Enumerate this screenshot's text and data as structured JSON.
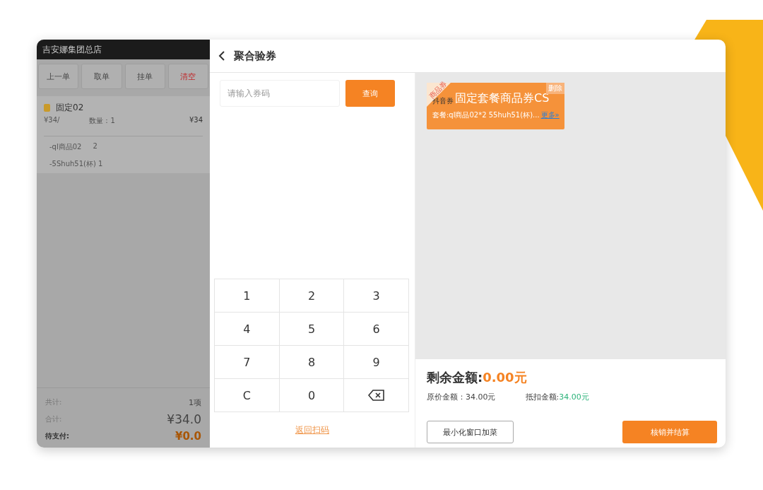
{
  "store": {
    "name": "吉安娜集团总店"
  },
  "order_buttons": [
    {
      "label": "上一单",
      "kind": "normal"
    },
    {
      "label": "取单",
      "kind": "normal"
    },
    {
      "label": "挂单",
      "kind": "normal"
    },
    {
      "label": "清空",
      "kind": "danger"
    }
  ],
  "order_item": {
    "name": "固定02",
    "unit_price": "¥34/",
    "quantity": "数量：1",
    "price": "¥34",
    "sub_items": [
      {
        "name": "-ql商品02",
        "count": "2"
      },
      {
        "name": "-5Shuh51(杯) 1"
      }
    ]
  },
  "totals": [
    {
      "label": "共计:",
      "value": "1项",
      "kind": "count"
    },
    {
      "label": "合计:",
      "value": "¥34.0",
      "kind": "total"
    },
    {
      "label": "待支付:",
      "value": "¥0.0",
      "kind": "due"
    }
  ],
  "header": {
    "title": "聚合验券"
  },
  "search": {
    "placeholder": "请输入券码",
    "button": "查询"
  },
  "keypad": [
    {
      "label": "1",
      "kind": "key"
    },
    {
      "label": "2",
      "kind": "key"
    },
    {
      "label": "3",
      "kind": "key"
    },
    {
      "label": "4",
      "kind": "key"
    },
    {
      "label": "5",
      "kind": "key"
    },
    {
      "label": "6",
      "kind": "key"
    },
    {
      "label": "7",
      "kind": "key"
    },
    {
      "label": "8",
      "kind": "key"
    },
    {
      "label": "9",
      "kind": "key"
    },
    {
      "label": "C",
      "kind": "key"
    },
    {
      "label": "0",
      "kind": "key"
    },
    {
      "kind": "backspace"
    }
  ],
  "back_link": "返回扫码",
  "coupon": {
    "corner": "商品券",
    "platform": "抖音券",
    "title": "固定套餐商品券CS",
    "tag": "删除",
    "desc": "套餐:ql商品02*2 55huh51(杯)...",
    "more": "更多»"
  },
  "summary": {
    "remaining_label": "剩余金额:",
    "remaining_value": "0.00元",
    "original_label": "原价金额：",
    "original_value": "34.00元",
    "deduct_label": "抵扣金额:",
    "deduct_value": "34.00元"
  },
  "buttons": {
    "minimize": "最小化窗口加菜",
    "confirm": "核销并结算"
  }
}
